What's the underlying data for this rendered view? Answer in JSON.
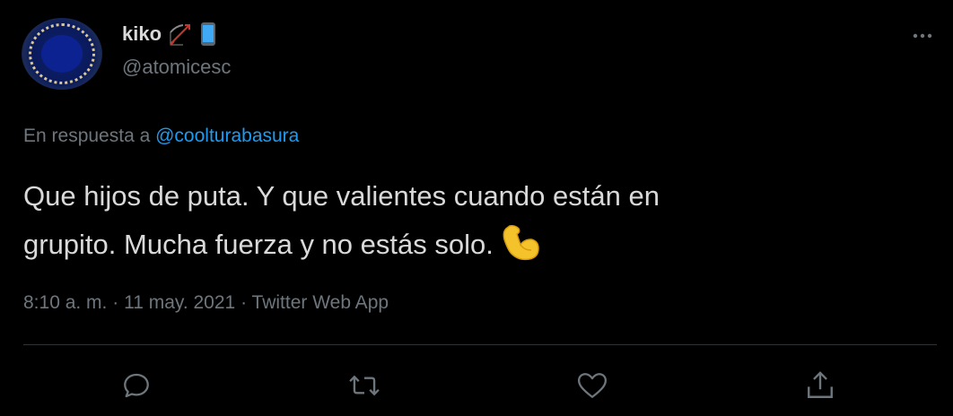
{
  "user": {
    "display_name": "kiko",
    "name_emojis": [
      "bow-and-arrow-emoji",
      "mobile-phone-emoji"
    ],
    "handle": "@atomicesc"
  },
  "reply": {
    "prefix": "En respuesta a",
    "mention": "@coolturabasura"
  },
  "tweet": {
    "line1": "Que hijos de puta. Y que valientes cuando están en",
    "line2": "grupito. Mucha fuerza y no estás solo.",
    "trailing_emoji": "flexed-biceps-emoji"
  },
  "meta": {
    "time": "8:10 a. m.",
    "date": "11 may. 2021",
    "source": "Twitter Web App",
    "separator": "·"
  },
  "actions": [
    {
      "name": "reply-icon"
    },
    {
      "name": "retweet-icon"
    },
    {
      "name": "like-icon"
    },
    {
      "name": "share-icon"
    }
  ],
  "colors": {
    "background": "#000000",
    "text": "#d9d9d9",
    "secondary_text": "#6e767d",
    "link": "#1d9bf0",
    "divider": "#2f3336"
  }
}
